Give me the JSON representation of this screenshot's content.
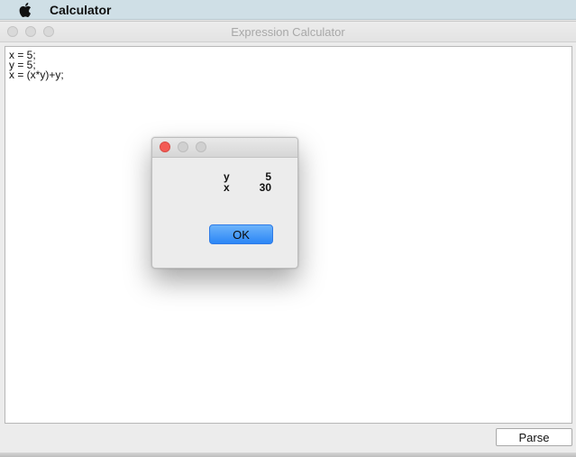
{
  "menubar": {
    "app_name": "Calculator"
  },
  "window": {
    "title": "Expression Calculator",
    "code_lines": [
      "x = 5;",
      "y = 5;",
      "x = (x*y)+y;"
    ],
    "parse_label": "Parse"
  },
  "dialog": {
    "results": [
      {
        "name": "y",
        "value": "5"
      },
      {
        "name": "x",
        "value": "30"
      }
    ],
    "ok_label": "OK"
  },
  "colors": {
    "menubar_bg": "#cfdfe6",
    "ok_button": "#2b86f6",
    "close_dot": "#f35b55"
  },
  "icons": [
    "apple-icon",
    "close-dot-icon",
    "minimize-dot-icon",
    "zoom-dot-icon"
  ]
}
